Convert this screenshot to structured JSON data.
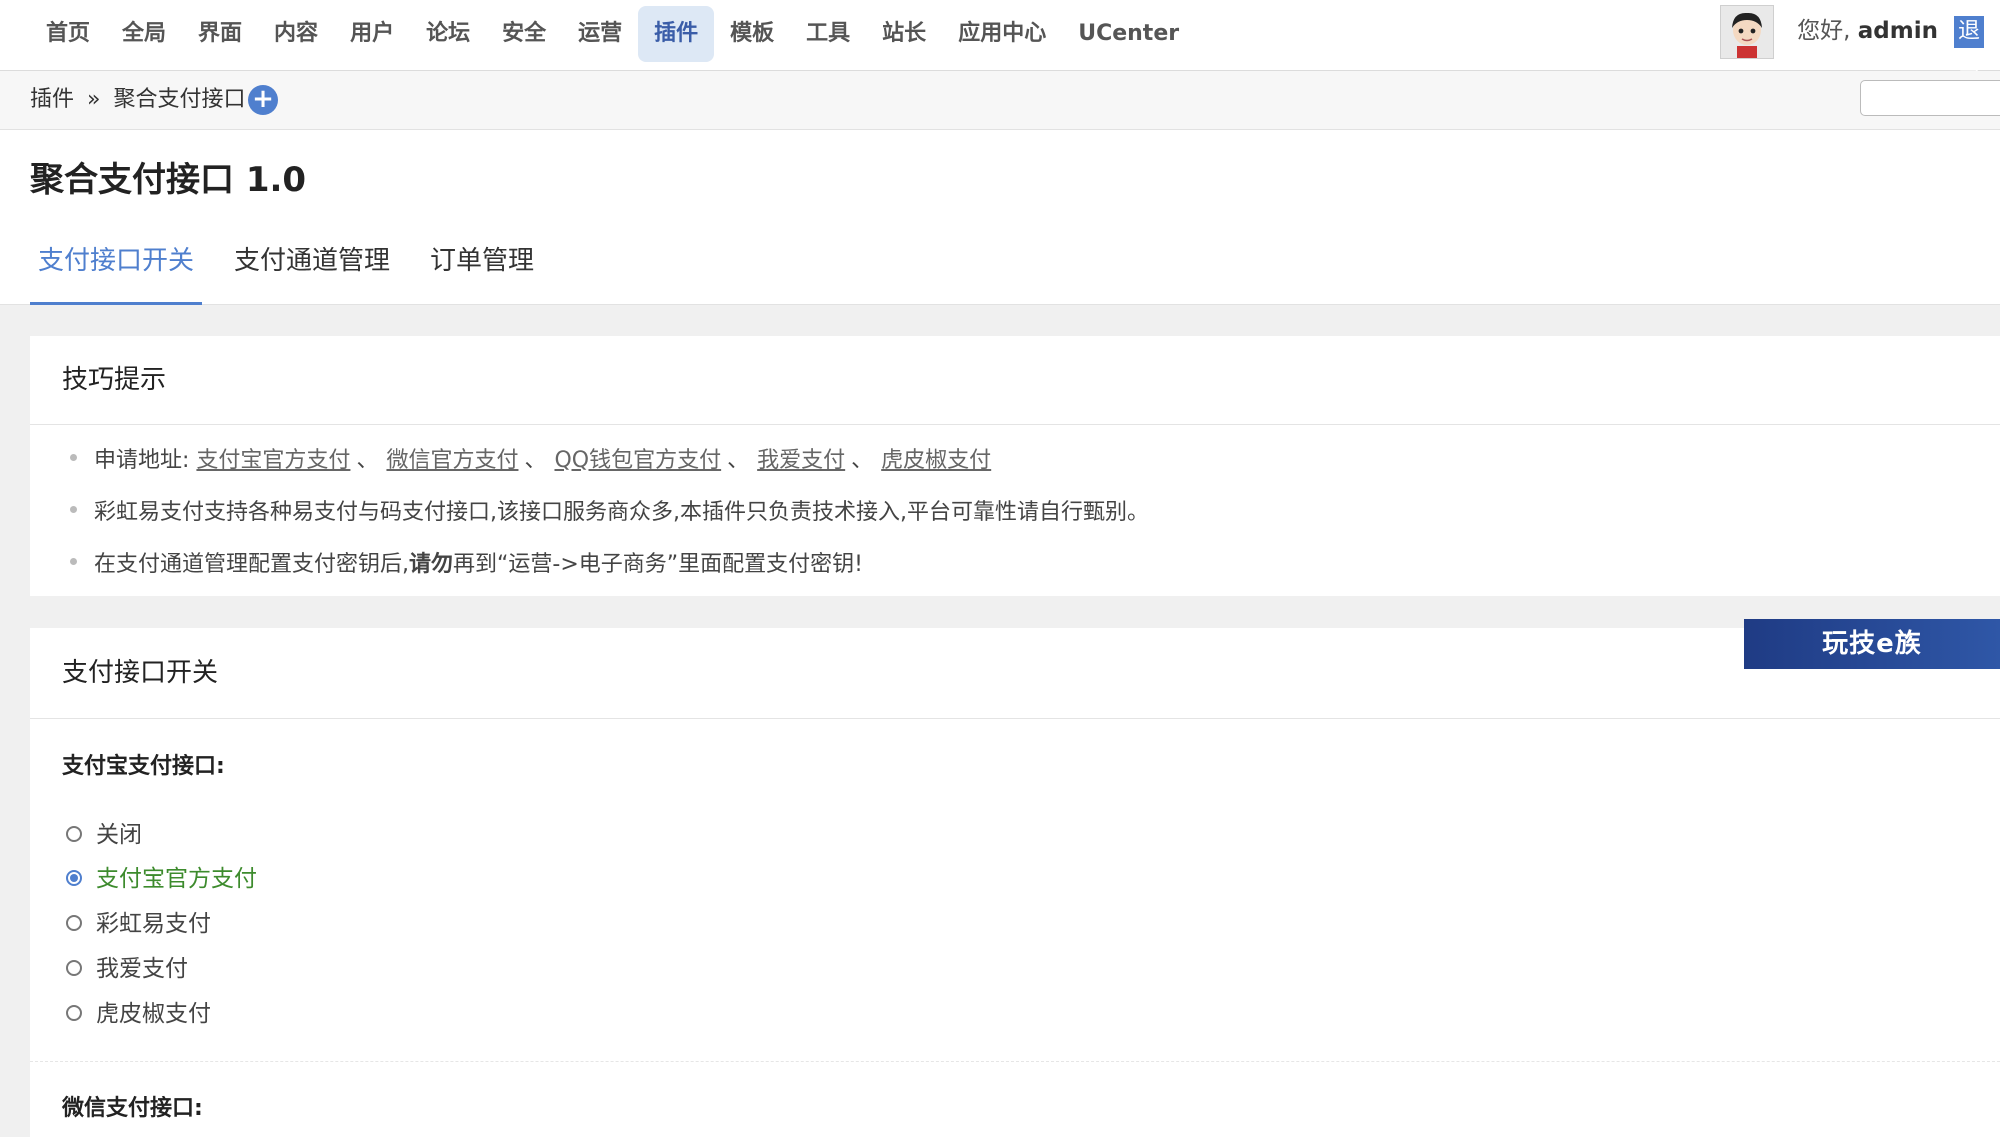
{
  "nav": {
    "items": [
      "首页",
      "全局",
      "界面",
      "内容",
      "用户",
      "论坛",
      "安全",
      "运营",
      "插件",
      "模板",
      "工具",
      "站长",
      "应用中心",
      "UCenter"
    ],
    "active_index": 8
  },
  "user": {
    "greeting": "您好,",
    "name": "admin",
    "logout_label": "退出"
  },
  "breadcrumb": {
    "parent": "插件",
    "separator": "»",
    "current": "聚合支付接口",
    "add_icon": "plus-icon"
  },
  "page": {
    "title": "聚合支付接口 1.0"
  },
  "tabs": [
    {
      "label": "支付接口开关",
      "active": true
    },
    {
      "label": "支付通道管理",
      "active": false
    },
    {
      "label": "订单管理",
      "active": false
    }
  ],
  "tips": {
    "title": "技巧提示",
    "apply_prefix": "申请地址:",
    "links": [
      "支付宝官方支付",
      "微信官方支付",
      "QQ钱包官方支付",
      "我爱支付",
      "虎皮椒支付"
    ],
    "link_separator": "、",
    "line2": "彩虹易支付支持各种易支付与码支付接口,该接口服务商众多,本插件只负责技术接入,平台可靠性请自行甄别。",
    "line3_pre": "在支付通道管理配置支付密钥后,",
    "line3_bold": "请勿",
    "line3_post": "再到“运营->电子商务”里面配置支付密钥!"
  },
  "switch": {
    "title": "支付接口开关",
    "alipay": {
      "label": "支付宝支付接口:",
      "options": [
        "关闭",
        "支付宝官方支付",
        "彩虹易支付",
        "我爱支付",
        "虎皮椒支付"
      ],
      "selected_index": 1
    },
    "wechat": {
      "label": "微信支付接口:"
    }
  },
  "watermark": {
    "text": "玩技e族"
  },
  "colors": {
    "accent": "#4f7fce",
    "selected_option": "#3d8b2d",
    "nav_active_bg": "#dde8f5"
  }
}
